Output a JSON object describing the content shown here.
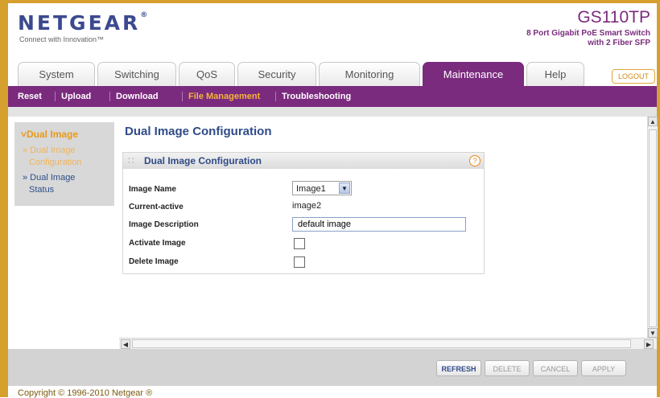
{
  "brand": {
    "logo": "NETGEAR",
    "logo_mark": "®",
    "tagline": "Connect with Innovation™"
  },
  "product": {
    "model": "GS110TP",
    "desc_line1": "8 Port Gigabit PoE Smart Switch",
    "desc_line2": "with 2 Fiber SFP"
  },
  "tabs": [
    {
      "label": "System"
    },
    {
      "label": "Switching"
    },
    {
      "label": "QoS"
    },
    {
      "label": "Security"
    },
    {
      "label": "Monitoring"
    },
    {
      "label": "Maintenance"
    },
    {
      "label": "Help"
    }
  ],
  "logout_label": "LOGOUT",
  "subnav": [
    {
      "label": "Reset"
    },
    {
      "label": "Upload"
    },
    {
      "label": "Download"
    },
    {
      "label": "File Management"
    },
    {
      "label": "Troubleshooting"
    }
  ],
  "sidebar": {
    "title": "Dual Image",
    "items": [
      {
        "line1": "» Dual Image",
        "line2": "Configuration"
      },
      {
        "line1": "» Dual Image",
        "line2": "Status"
      }
    ]
  },
  "page_title": "Dual Image Configuration",
  "panel": {
    "title": "Dual Image Configuration",
    "help": "?",
    "labels": {
      "image_name": "Image Name",
      "current_active": "Current-active",
      "image_description": "Image Description",
      "activate_image": "Activate Image",
      "delete_image": "Delete Image"
    },
    "image_name_value": "Image1",
    "current_active_value": "image2",
    "image_description_value": "default image"
  },
  "buttons": {
    "refresh": "REFRESH",
    "delete": "DELETE",
    "cancel": "CANCEL",
    "apply": "APPLY"
  },
  "copyright": "Copyright © 1996-2010 Netgear ®",
  "icons": {
    "select_arrow": "chevron-down-icon",
    "help": "help-icon"
  },
  "colors": {
    "accent_purple": "#7a2b7e",
    "frame_gold": "#d6a02e",
    "title_blue": "#2f4b88",
    "active_orange": "#f7b43b"
  }
}
